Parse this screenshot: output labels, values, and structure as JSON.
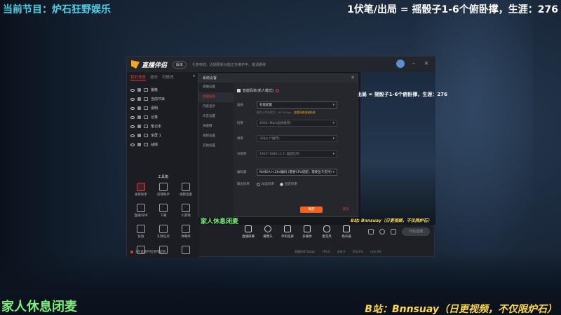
{
  "overlay": {
    "program_label": "当前节目：炉石狂野娱乐",
    "rule_text": "1伏笔/出局 = 摇骰子1-6个俯卧撑，生涯：276",
    "rest_notice": "家人休息闭麦",
    "bilibili_text": "B站：Bnnsuay（日更视频，不仅限炉石）"
  },
  "app": {
    "name": "直播伴侣",
    "version_badge": "版本",
    "notice": "礼物特效、近期更新功能正在维护中，敬请期待"
  },
  "scene_panel": {
    "tabs": [
      "我的场景",
      "双击",
      "可修改"
    ],
    "add_label": "+",
    "sources": [
      "摄像",
      "当前节目",
      "说明",
      "记录",
      "笔记本",
      "全屏 1",
      "战绩"
    ],
    "tools_title": "工具箱",
    "tools": [
      "录屏助手",
      "房管助手",
      "视频连麦",
      "直播间PK",
      "下载",
      "小游戏",
      "投放",
      "礼物任务",
      "弹幕库",
      "",
      "",
      ""
    ],
    "footer": "1条直播伴侣使用说明"
  },
  "preview": {
    "mini_text": "出局 = 摇骰子1-6个俯卧撑，生涯：276",
    "left_label": "家人休息闭麦",
    "right_label": "B站: Bnnsuay（日更视频，不仅限炉石）"
  },
  "settings_dialog": {
    "title": "系统设置",
    "nav": [
      "直播设置",
      "直播画质",
      "内容显示",
      "声音设置",
      "快捷键",
      "视频设置",
      "其他设置"
    ],
    "nav_active_index": 1,
    "smart_mode_label": "智能码率(新人模式)",
    "fields": [
      {
        "label": "画质",
        "value": "智能配置",
        "bright": true
      },
      {
        "label": "码率",
        "value": "4000 (Mb/s画质推荐)",
        "bright": false
      },
      {
        "label": "帧率",
        "value": "30fps (*推荐)",
        "bright": false
      },
      {
        "label": "分辨率",
        "value": "1920*1080 (1:1) 画面比例",
        "bright": false
      }
    ],
    "hint_prefix": "推荐上传带宽为：8013Kbps，",
    "hint_link": "查看网络测速结果",
    "encoder_label": "编码器",
    "encoder_value": "NVIDIA H.264编码 (需要CPU适配，需要显卡支持)",
    "output_label": "输出码率",
    "output_options": [
      "动态码率",
      "固定码率"
    ],
    "output_selected_index": 1,
    "ok_label": "确定",
    "cancel_label": "取消"
  },
  "bottom_bar": {
    "items": [
      "直播屏幕",
      "摄像头",
      "手机投屏",
      "多媒体",
      "麦克风",
      "扬声器"
    ],
    "live_button": "开始直播"
  },
  "status_bar": {
    "items": [
      "直播码率:0kbps",
      "FPS:0",
      "丢帧:0",
      "CPU:0%",
      "内存:0%"
    ]
  }
}
